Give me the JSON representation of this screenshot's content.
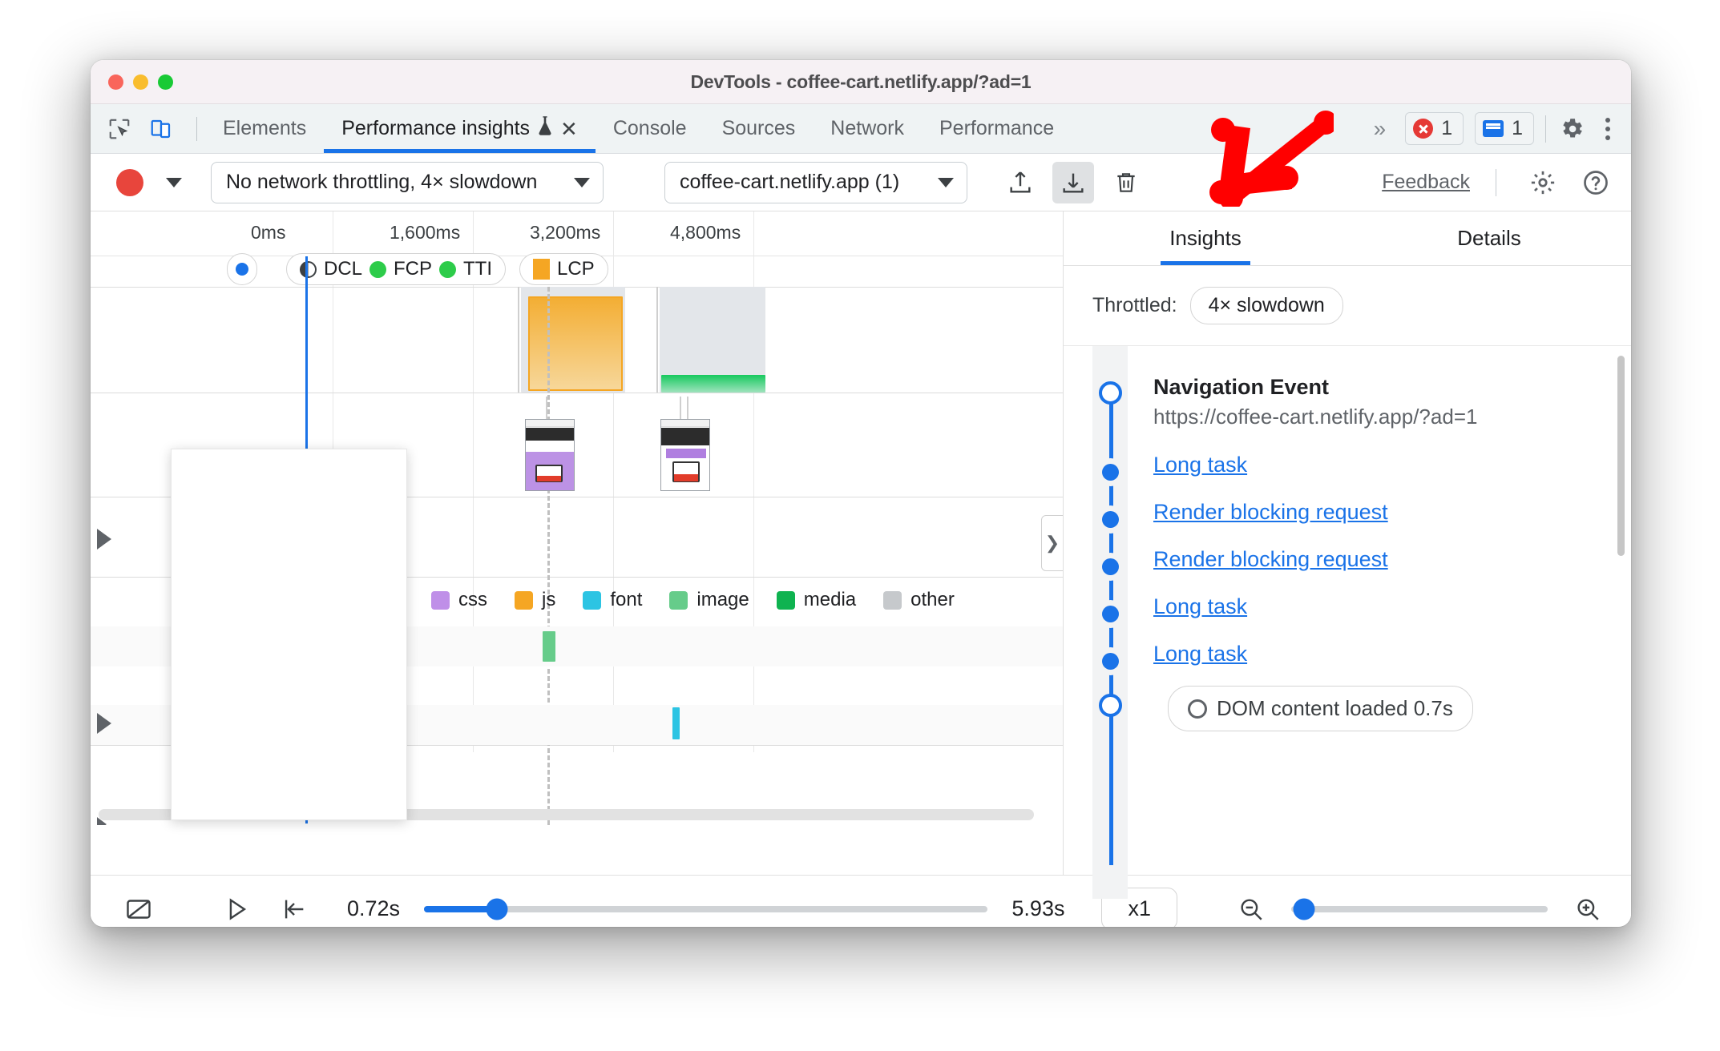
{
  "window": {
    "title": "DevTools - coffee-cart.netlify.app/?ad=1",
    "traffic_lights": [
      "close",
      "minimize",
      "zoom"
    ]
  },
  "tabbar": {
    "left_icons": [
      {
        "name": "inspect-element-icon"
      },
      {
        "name": "device-toolbar-icon"
      }
    ],
    "tabs": [
      {
        "label": "Elements",
        "active": false
      },
      {
        "label": "Performance insights",
        "active": true,
        "experimental": true,
        "closable": true
      },
      {
        "label": "Console",
        "active": false
      },
      {
        "label": "Sources",
        "active": false
      },
      {
        "label": "Network",
        "active": false
      },
      {
        "label": "Performance",
        "active": false
      }
    ],
    "overflow_label": "»",
    "error_count": "1",
    "message_count": "1"
  },
  "toolbar": {
    "record_label": "record",
    "throttling": "No network throttling, 4× slowdown",
    "trace_select": "coffee-cart.netlify.app (1)",
    "upload_label": "Upload profile",
    "download_label": "Download profile",
    "delete_label": "Delete profile",
    "feedback": "Feedback",
    "settings_label": "Settings",
    "help_label": "Help"
  },
  "timeline": {
    "ticks": [
      "0ms",
      "1,600ms",
      "3,200ms",
      "4,800ms"
    ],
    "markers": [
      {
        "label": "DCL",
        "color": "#3c4043",
        "shape": "half"
      },
      {
        "label": "FCP",
        "color": "#2dcc4a",
        "shape": "circle"
      },
      {
        "label": "TTI",
        "color": "#2dcc4a",
        "shape": "circle"
      },
      {
        "label": "LCP",
        "color": "#f5a623",
        "shape": "square"
      }
    ],
    "legend": [
      {
        "label": "css",
        "color": "#bf8fe8"
      },
      {
        "label": "js",
        "color": "#f5a623"
      },
      {
        "label": "font",
        "color": "#2cc4e3"
      },
      {
        "label": "media",
        "color": "#0fb350"
      },
      {
        "label": "image",
        "color": "#66cc8a"
      },
      {
        "label": "other",
        "color": "#c6c9cc"
      }
    ]
  },
  "right_panel": {
    "tabs": [
      {
        "label": "Insights",
        "active": true
      },
      {
        "label": "Details",
        "active": false
      }
    ],
    "throttled_label": "Throttled:",
    "throttled_value": "4× slowdown",
    "navigation_title": "Navigation Event",
    "navigation_url": "https://coffee-cart.netlify.app/?ad=1",
    "items": [
      {
        "label": "Long task"
      },
      {
        "label": "Render blocking request"
      },
      {
        "label": "Render blocking request"
      },
      {
        "label": "Long task"
      },
      {
        "label": "Long task"
      }
    ],
    "dom_chip": "DOM content loaded 0.7s"
  },
  "footer": {
    "screenshot_toggle_label": "Toggle screenshots",
    "play_label": "Play",
    "reset_label": "Jump to start",
    "start_time": "0.72s",
    "end_time": "5.93s",
    "speed": "x1",
    "zoom_out_label": "Zoom out",
    "zoom_in_label": "Zoom in"
  },
  "annotation": {
    "arrow_color": "#ff0000",
    "points_to": "download-profile-button"
  },
  "colors": {
    "accent": "#1a73e8",
    "error": "#e53935",
    "record": "#e8453c"
  }
}
